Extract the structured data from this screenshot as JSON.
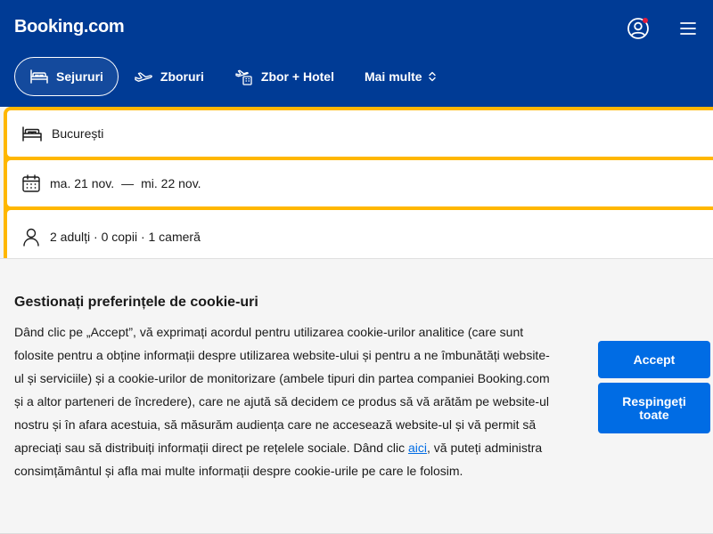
{
  "header": {
    "logo": "Booking.com",
    "account_icon": "user-circle-icon",
    "menu_icon": "hamburger-menu-icon",
    "notification_color": "#e21c3c",
    "brand_color": "#003b95"
  },
  "nav": {
    "tabs": [
      {
        "label": "Sejururi",
        "icon": "bed-icon",
        "active": true
      },
      {
        "label": "Zboruri",
        "icon": "plane-icon",
        "active": false
      },
      {
        "label": "Zbor + Hotel",
        "icon": "plane-hotel-icon",
        "active": false
      },
      {
        "label": "Mai multe",
        "icon": "chevron-updown-icon",
        "active": false
      }
    ]
  },
  "search": {
    "accent_color": "#ffb700",
    "destination": "București",
    "checkin": "ma. 21 nov.",
    "date_separator": "—",
    "checkout": "mi. 22 nov.",
    "occupancy": "2 adulți · 0 copii · 1 cameră"
  },
  "cookie_banner": {
    "title": "Gestionați preferințele de cookie-uri",
    "text_before_link": "Dând clic pe „Accept”, vă exprimați acordul pentru utilizarea cookie-urilor analitice (care sunt folosite pentru a obține informații despre utilizarea website-ului și pentru a ne îmbunătăți website-ul și serviciile) și a cookie-urilor de monitorizare (ambele tipuri din partea companiei Booking.com și a altor parteneri de încredere), care ne ajută să decidem ce produs să vă arătăm pe website-ul nostru și în afara acestuia, să măsurăm audiența care ne accesează website-ul și vă permit să apreciați sau să distribuiți informații direct pe rețelele sociale. Dând clic ",
    "link_text": "aici",
    "text_after_link": ", vă puteți administra consimțământul și afla mai multe informații despre cookie-urile pe care le folosim.",
    "accept_label": "Accept",
    "reject_label": "Respingeți toate",
    "button_color": "#006ce4"
  }
}
